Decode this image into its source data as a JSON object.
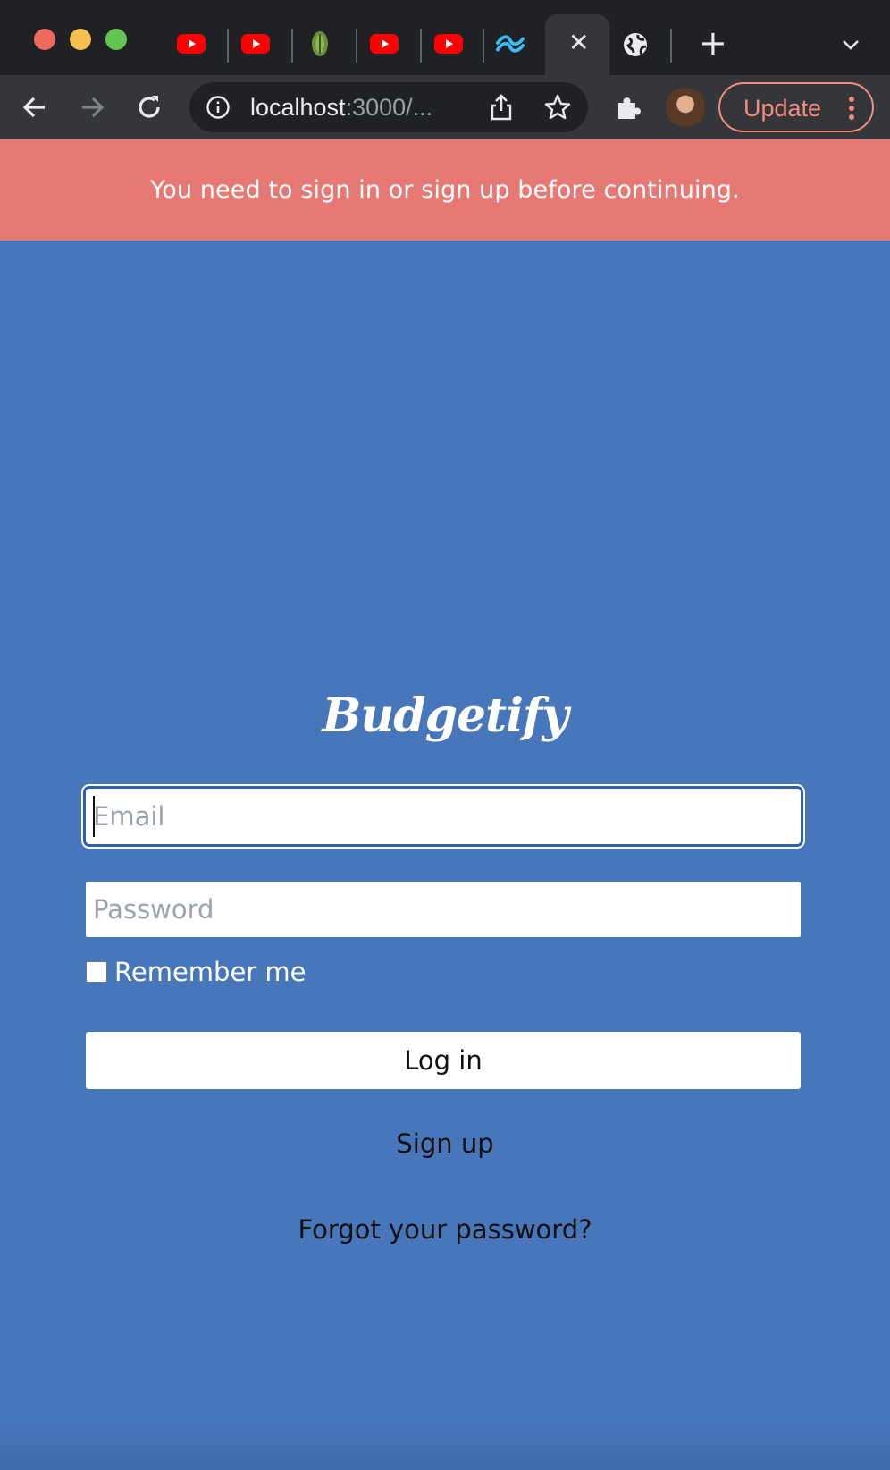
{
  "browser": {
    "address_host": "localhost",
    "address_rest": ":3000/...",
    "update_label": "Update",
    "tabs": [
      {
        "icon": "youtube-icon"
      },
      {
        "icon": "youtube-icon"
      },
      {
        "icon": "leaf-icon"
      },
      {
        "icon": "youtube-icon"
      },
      {
        "icon": "youtube-icon"
      },
      {
        "icon": "tailwind-icon"
      },
      {
        "icon": "close-icon",
        "active": true
      },
      {
        "icon": "globe-icon"
      }
    ]
  },
  "flash": {
    "message": "You need to sign in or sign up before continuing."
  },
  "brand": {
    "name": "Budgetify"
  },
  "form": {
    "email_placeholder": "Email",
    "password_placeholder": "Password",
    "remember_label": "Remember me",
    "login_label": "Log in"
  },
  "links": {
    "signup": "Sign up",
    "forgot": "Forgot your password?"
  },
  "colors": {
    "page_background": "#4876bb",
    "flash_background": "#e67973",
    "focus_ring": "#2f5fb3",
    "update_accent": "#f28b82"
  }
}
